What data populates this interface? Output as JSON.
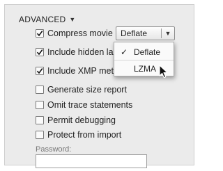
{
  "section": {
    "title": "ADVANCED",
    "caret_icon": "triangle-down-icon"
  },
  "options": [
    {
      "label": "Compress movie",
      "checked": true
    },
    {
      "label": "Include hidden la",
      "checked": true
    },
    {
      "label": "Include XMP met",
      "checked": true
    },
    {
      "label": "Generate size report",
      "checked": false
    },
    {
      "label": "Omit trace statements",
      "checked": false
    },
    {
      "label": "Permit debugging",
      "checked": false
    },
    {
      "label": "Protect from import",
      "checked": false
    }
  ],
  "compression": {
    "selected": "Deflate",
    "menu": [
      {
        "label": "Deflate",
        "checked": true
      },
      {
        "label": "LZMA",
        "checked": false
      }
    ]
  },
  "password": {
    "label": "Password:",
    "value": ""
  }
}
